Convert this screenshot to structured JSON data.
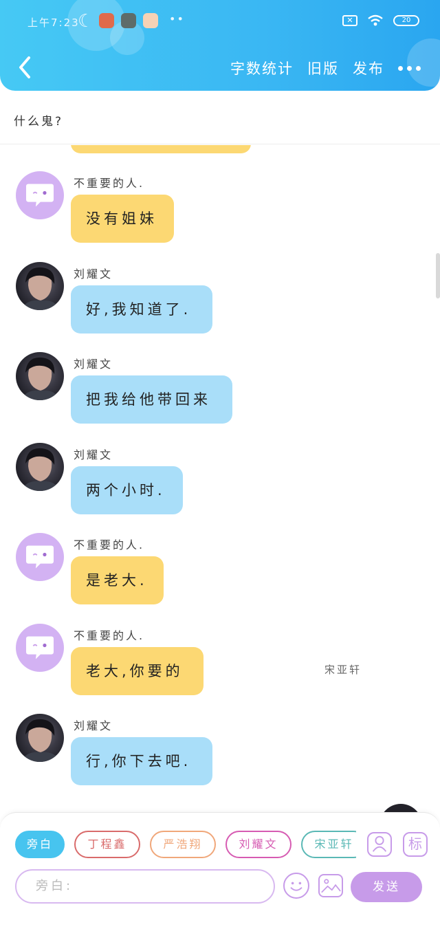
{
  "status_bar": {
    "time": "上午7:23",
    "battery": "20"
  },
  "header": {
    "word_count_label": "字数统计",
    "old_version_label": "旧版",
    "publish_label": "发布"
  },
  "topic": {
    "title": "什么鬼?"
  },
  "messages": [
    {
      "sender": "不重要的人.",
      "text": "没有姐妹",
      "color": "yellow",
      "avatar": "ghost"
    },
    {
      "sender": "刘耀文",
      "text": "好,我知道了.",
      "color": "blue",
      "avatar": "photo"
    },
    {
      "sender": "刘耀文",
      "text": "把我给他带回来",
      "color": "blue",
      "avatar": "photo"
    },
    {
      "sender": "刘耀文",
      "text": "两个小时.",
      "color": "blue",
      "avatar": "photo"
    },
    {
      "sender": "不重要的人.",
      "text": "是老大.",
      "color": "yellow",
      "avatar": "ghost"
    },
    {
      "sender": "不重要的人.",
      "text": "老大,你要的",
      "color": "yellow",
      "avatar": "ghost"
    },
    {
      "sender": "刘耀文",
      "text": "行,你下去吧.",
      "color": "blue",
      "avatar": "photo"
    }
  ],
  "partial_right_sender": "宋亚轩",
  "composer": {
    "roles": [
      "旁白",
      "丁程鑫",
      "严浩翔",
      "刘耀文",
      "宋亚轩"
    ],
    "tag_label": "标",
    "input_placeholder": "旁白:",
    "send_label": "发送"
  },
  "colors": {
    "header_blue": "#3ab7f3",
    "bubble_yellow": "#fcd873",
    "bubble_blue": "#a9def9",
    "ghost_purple": "#d3b2f3",
    "accent_purple": "#c79be9"
  }
}
